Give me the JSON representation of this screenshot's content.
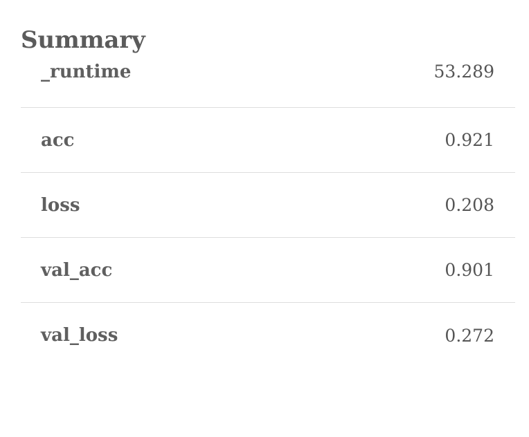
{
  "summary": {
    "title": "Summary",
    "rows": [
      {
        "key": "_runtime",
        "value": "53.289"
      },
      {
        "key": "acc",
        "value": "0.921"
      },
      {
        "key": "loss",
        "value": "0.208"
      },
      {
        "key": "val_acc",
        "value": "0.901"
      },
      {
        "key": "val_loss",
        "value": "0.272"
      }
    ]
  }
}
